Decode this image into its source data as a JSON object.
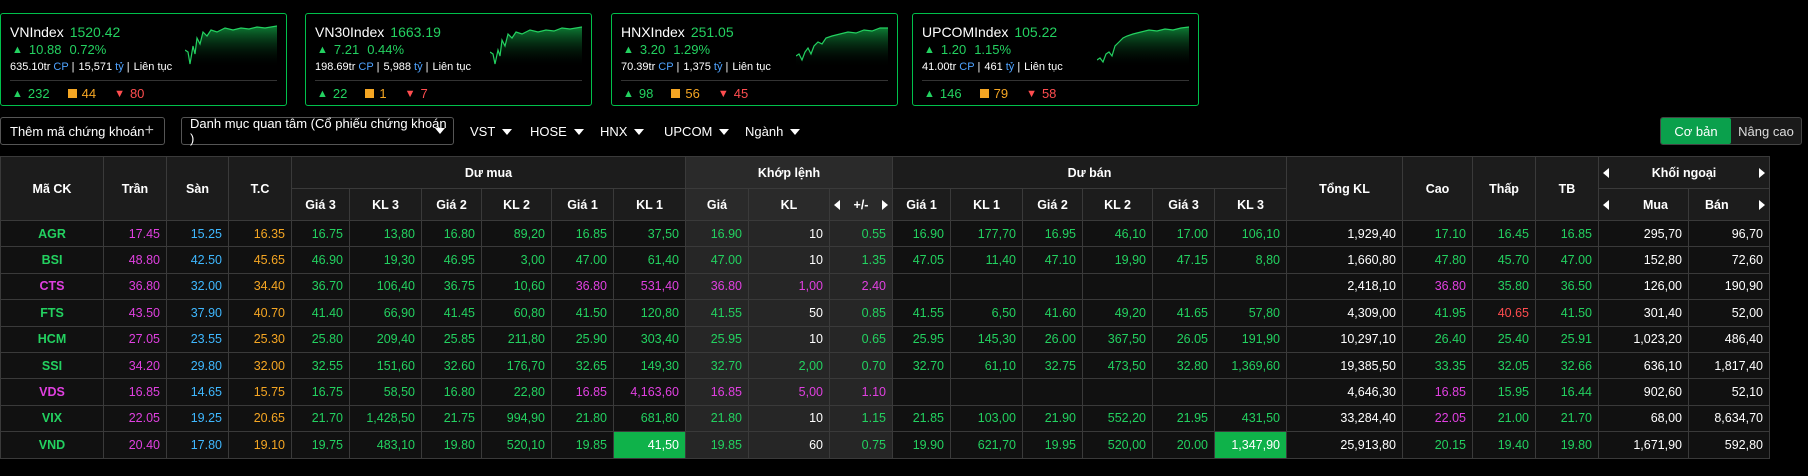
{
  "indices": [
    {
      "name": "VNIndex",
      "value": "1520.42",
      "change": "10.88",
      "pct": "0.72%",
      "volume": "635.10tr",
      "vol_unit": "CP",
      "value_traded": "15,571",
      "val_unit": "tỷ",
      "session": "Liên tục",
      "up": "232",
      "ref": "44",
      "down": "80"
    },
    {
      "name": "VN30Index",
      "value": "1663.19",
      "change": "7.21",
      "pct": "0.44%",
      "volume": "198.69tr",
      "vol_unit": "CP",
      "value_traded": "5,988",
      "val_unit": "tỷ",
      "session": "Liên tục",
      "up": "22",
      "ref": "1",
      "down": "7"
    },
    {
      "name": "HNXIndex",
      "value": "251.05",
      "change": "3.20",
      "pct": "1.29%",
      "volume": "70.39tr",
      "vol_unit": "CP",
      "value_traded": "1,375",
      "val_unit": "tỷ",
      "session": "Liên tục",
      "up": "98",
      "ref": "56",
      "down": "45"
    },
    {
      "name": "UPCOMIndex",
      "value": "105.22",
      "change": "1.20",
      "pct": "1.15%",
      "volume": "41.00tr",
      "vol_unit": "CP",
      "value_traded": "461",
      "val_unit": "tỷ",
      "session": "Liên tục",
      "up": "146",
      "ref": "79",
      "down": "58"
    }
  ],
  "toolbar": {
    "add_label": "Thêm mã chứng khoán",
    "watchlist_label": "Danh mục quan tâm (Cổ phiếu chứng khoán )",
    "filters": [
      "VST",
      "HOSE",
      "HNX",
      "UPCOM",
      "Ngành"
    ],
    "mode_basic": "Cơ bản",
    "mode_advanced": "Nâng cao"
  },
  "table": {
    "h_symbol": "Mã CK",
    "h_ceil": "Trần",
    "h_floor": "Sàn",
    "h_ref": "T.C",
    "h_bid": "Dư mua",
    "h_match": "Khớp lệnh",
    "h_ask": "Dư bán",
    "h_total": "Tổng KL",
    "h_high": "Cao",
    "h_low": "Thấp",
    "h_avg": "TB",
    "h_foreign": "Khối ngoại",
    "sub_bid": [
      "Giá 3",
      "KL 3",
      "Giá 2",
      "KL 2",
      "Giá 1",
      "KL 1"
    ],
    "sub_match": [
      "Giá",
      "KL",
      "+/-"
    ],
    "sub_ask": [
      "Giá 1",
      "KL 1",
      "Giá 2",
      "KL 2",
      "Giá 3",
      "KL 3"
    ],
    "sub_foreign": [
      "Mua",
      "Bán"
    ],
    "rows": [
      {
        "sym": "AGR",
        "ceil": "17.45",
        "floor": "15.25",
        "ref": "16.35",
        "bid": [
          "16.75",
          "13,80",
          "16.80",
          "89,20",
          "16.85",
          "37,50"
        ],
        "match": [
          "16.90",
          "10",
          "0.55"
        ],
        "ask": [
          "16.90",
          "177,70",
          "16.95",
          "46,10",
          "17.00",
          "106,10"
        ],
        "total": "1,929,40",
        "high": "17.10",
        "low": "16.45",
        "avg": "16.85",
        "fbuy": "295,70",
        "fsell": "96,70"
      },
      {
        "sym": "BSI",
        "ceil": "48.80",
        "floor": "42.50",
        "ref": "45.65",
        "bid": [
          "46.90",
          "19,30",
          "46.95",
          "3,00",
          "47.00",
          "61,40"
        ],
        "match": [
          "47.00",
          "10",
          "1.35"
        ],
        "ask": [
          "47.05",
          "11,40",
          "47.10",
          "19,90",
          "47.15",
          "8,80"
        ],
        "total": "1,660,80",
        "high": "47.80",
        "low": "45.70",
        "avg": "47.00",
        "fbuy": "152,80",
        "fsell": "72,60"
      },
      {
        "sym": "CTS",
        "ceil": "36.80",
        "floor": "32.00",
        "ref": "34.40",
        "bid": [
          "36.70",
          "106,40",
          "36.75",
          "10,60",
          "36.80",
          "531,40"
        ],
        "match": [
          "36.80",
          "1,00",
          "2.40"
        ],
        "ask": [
          "",
          "",
          "",
          "",
          "",
          ""
        ],
        "total": "2,418,10",
        "high": "36.80",
        "low": "35.80",
        "avg": "36.50",
        "fbuy": "126,00",
        "fsell": "190,90"
      },
      {
        "sym": "FTS",
        "ceil": "43.50",
        "floor": "37.90",
        "ref": "40.70",
        "bid": [
          "41.40",
          "66,90",
          "41.45",
          "60,80",
          "41.50",
          "120,80"
        ],
        "match": [
          "41.55",
          "50",
          "0.85"
        ],
        "ask": [
          "41.55",
          "6,50",
          "41.60",
          "49,20",
          "41.65",
          "57,80"
        ],
        "total": "4,309,00",
        "high": "41.95",
        "low": "40.65",
        "avg": "41.50",
        "fbuy": "301,40",
        "fsell": "52,00"
      },
      {
        "sym": "HCM",
        "ceil": "27.05",
        "floor": "23.55",
        "ref": "25.30",
        "bid": [
          "25.80",
          "209,40",
          "25.85",
          "211,80",
          "25.90",
          "303,40"
        ],
        "match": [
          "25.95",
          "10",
          "0.65"
        ],
        "ask": [
          "25.95",
          "145,30",
          "26.00",
          "367,50",
          "26.05",
          "191,90"
        ],
        "total": "10,297,10",
        "high": "26.40",
        "low": "25.40",
        "avg": "25.91",
        "fbuy": "1,023,20",
        "fsell": "486,40"
      },
      {
        "sym": "SSI",
        "ceil": "34.20",
        "floor": "29.80",
        "ref": "32.00",
        "bid": [
          "32.55",
          "151,60",
          "32.60",
          "176,70",
          "32.65",
          "149,30"
        ],
        "match": [
          "32.70",
          "2,00",
          "0.70"
        ],
        "ask": [
          "32.70",
          "61,10",
          "32.75",
          "473,50",
          "32.80",
          "1,369,60"
        ],
        "total": "19,385,50",
        "high": "33.35",
        "low": "32.05",
        "avg": "32.66",
        "fbuy": "636,10",
        "fsell": "1,817,40"
      },
      {
        "sym": "VDS",
        "ceil": "16.85",
        "floor": "14.65",
        "ref": "15.75",
        "bid": [
          "16.75",
          "58,50",
          "16.80",
          "22,80",
          "16.85",
          "4,163,60"
        ],
        "match": [
          "16.85",
          "5,00",
          "1.10"
        ],
        "ask": [
          "",
          "",
          "",
          "",
          "",
          ""
        ],
        "total": "4,646,30",
        "high": "16.85",
        "low": "15.95",
        "avg": "16.44",
        "fbuy": "902,60",
        "fsell": "52,10"
      },
      {
        "sym": "VIX",
        "ceil": "22.05",
        "floor": "19.25",
        "ref": "20.65",
        "bid": [
          "21.70",
          "1,428,50",
          "21.75",
          "994,90",
          "21.80",
          "681,80"
        ],
        "match": [
          "21.80",
          "10",
          "1.15"
        ],
        "ask": [
          "21.85",
          "103,00",
          "21.90",
          "552,20",
          "21.95",
          "431,50"
        ],
        "total": "33,284,40",
        "high": "22.05",
        "low": "21.00",
        "avg": "21.70",
        "fbuy": "68,00",
        "fsell": "8,634,70"
      },
      {
        "sym": "VND",
        "ceil": "20.40",
        "floor": "17.80",
        "ref": "19.10",
        "bid": [
          "19.75",
          "483,10",
          "19.80",
          "520,10",
          "19.85",
          "41,50"
        ],
        "match": [
          "19.85",
          "60",
          "0.75"
        ],
        "ask": [
          "19.90",
          "621,70",
          "19.95",
          "520,00",
          "20.00",
          "1,347,90"
        ],
        "total": "25,913,80",
        "high": "20.15",
        "low": "19.40",
        "avg": "19.80",
        "fbuy": "1,671,90",
        "fsell": "592,80"
      }
    ]
  },
  "colors": {
    "up": "#23d160",
    "ceil": "#e040e0",
    "floor": "#3fb8ff",
    "ref": "#f5a623",
    "down": "#ff4d4f",
    "accent": "#0aa04c"
  }
}
